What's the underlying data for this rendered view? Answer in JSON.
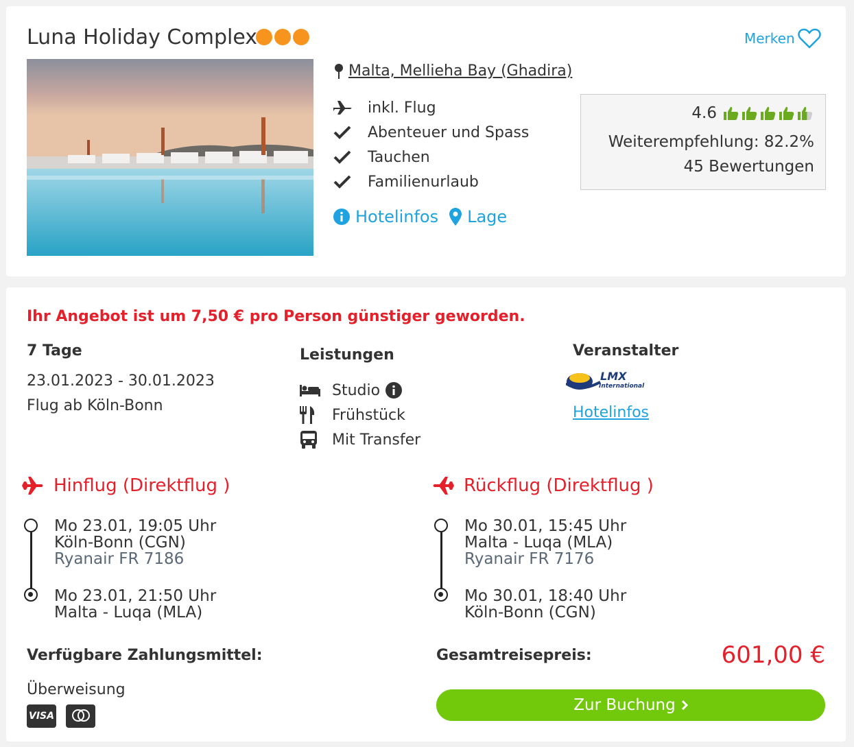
{
  "hotel": {
    "name": "Luna Holiday Complex",
    "stars": 3,
    "merken_label": "Merken",
    "location": "Malta, Mellieha Bay (Ghadira)",
    "features": [
      "inkl. Flug",
      "Abenteuer und Spass",
      "Tauchen",
      "Familienurlaub"
    ],
    "feature_icons": [
      "plane-icon",
      "check-icon",
      "check-icon",
      "check-icon"
    ],
    "links": {
      "hotelinfos": "Hotelinfos",
      "lage": "Lage"
    },
    "rating": {
      "score": "4.6",
      "thumbs_value": 4.6,
      "recommendation": "Weiterempfehlung: 82.2%",
      "reviews": "45 Bewertungen"
    }
  },
  "offer": {
    "price_change": "Ihr Angebot ist um 7,50 € pro Person günstiger geworden.",
    "duration": "7 Tage",
    "dates": "23.01.2023 - 30.01.2023",
    "departure": "Flug ab Köln-Bonn",
    "services_title": "Leistungen",
    "services": [
      {
        "label": "Studio",
        "icon": "bed-icon"
      },
      {
        "label": "Frühstück",
        "icon": "cutlery-icon"
      },
      {
        "label": "Mit Transfer",
        "icon": "bus-icon"
      }
    ],
    "operator_title": "Veranstalter",
    "operator_logo": {
      "big": "LMX",
      "small": "International"
    },
    "operator_link": "Hotelinfos"
  },
  "flights": {
    "outbound": {
      "title": "Hinflug (Direktflug )",
      "dep_time": "Mo 23.01, 19:05 Uhr",
      "dep_airport": "Köln-Bonn (CGN)",
      "airline": "Ryanair FR 7186",
      "arr_time": "Mo 23.01, 21:50 Uhr",
      "arr_airport": "Malta - Luqa (MLA)"
    },
    "return": {
      "title": "Rückflug (Direktflug )",
      "dep_time": "Mo 30.01, 15:45 Uhr",
      "dep_airport": "Malta - Luqa (MLA)",
      "airline": "Ryanair FR 7176",
      "arr_time": "Mo 30.01, 18:40 Uhr",
      "arr_airport": "Köln-Bonn (CGN)"
    }
  },
  "payment": {
    "title": "Verfügbare Zahlungsmittel:",
    "method": "Überweisung",
    "visa_label": "VISA"
  },
  "total": {
    "label": "Gesamtreisepreis:",
    "price": "601,00 €",
    "button": "Zur Buchung"
  },
  "colors": {
    "accent_blue": "#1fa3e0",
    "alert_red": "#e4202b",
    "star_orange": "#f7941d",
    "thumb_green": "#6aaa1e",
    "button_green": "#72c80a"
  }
}
